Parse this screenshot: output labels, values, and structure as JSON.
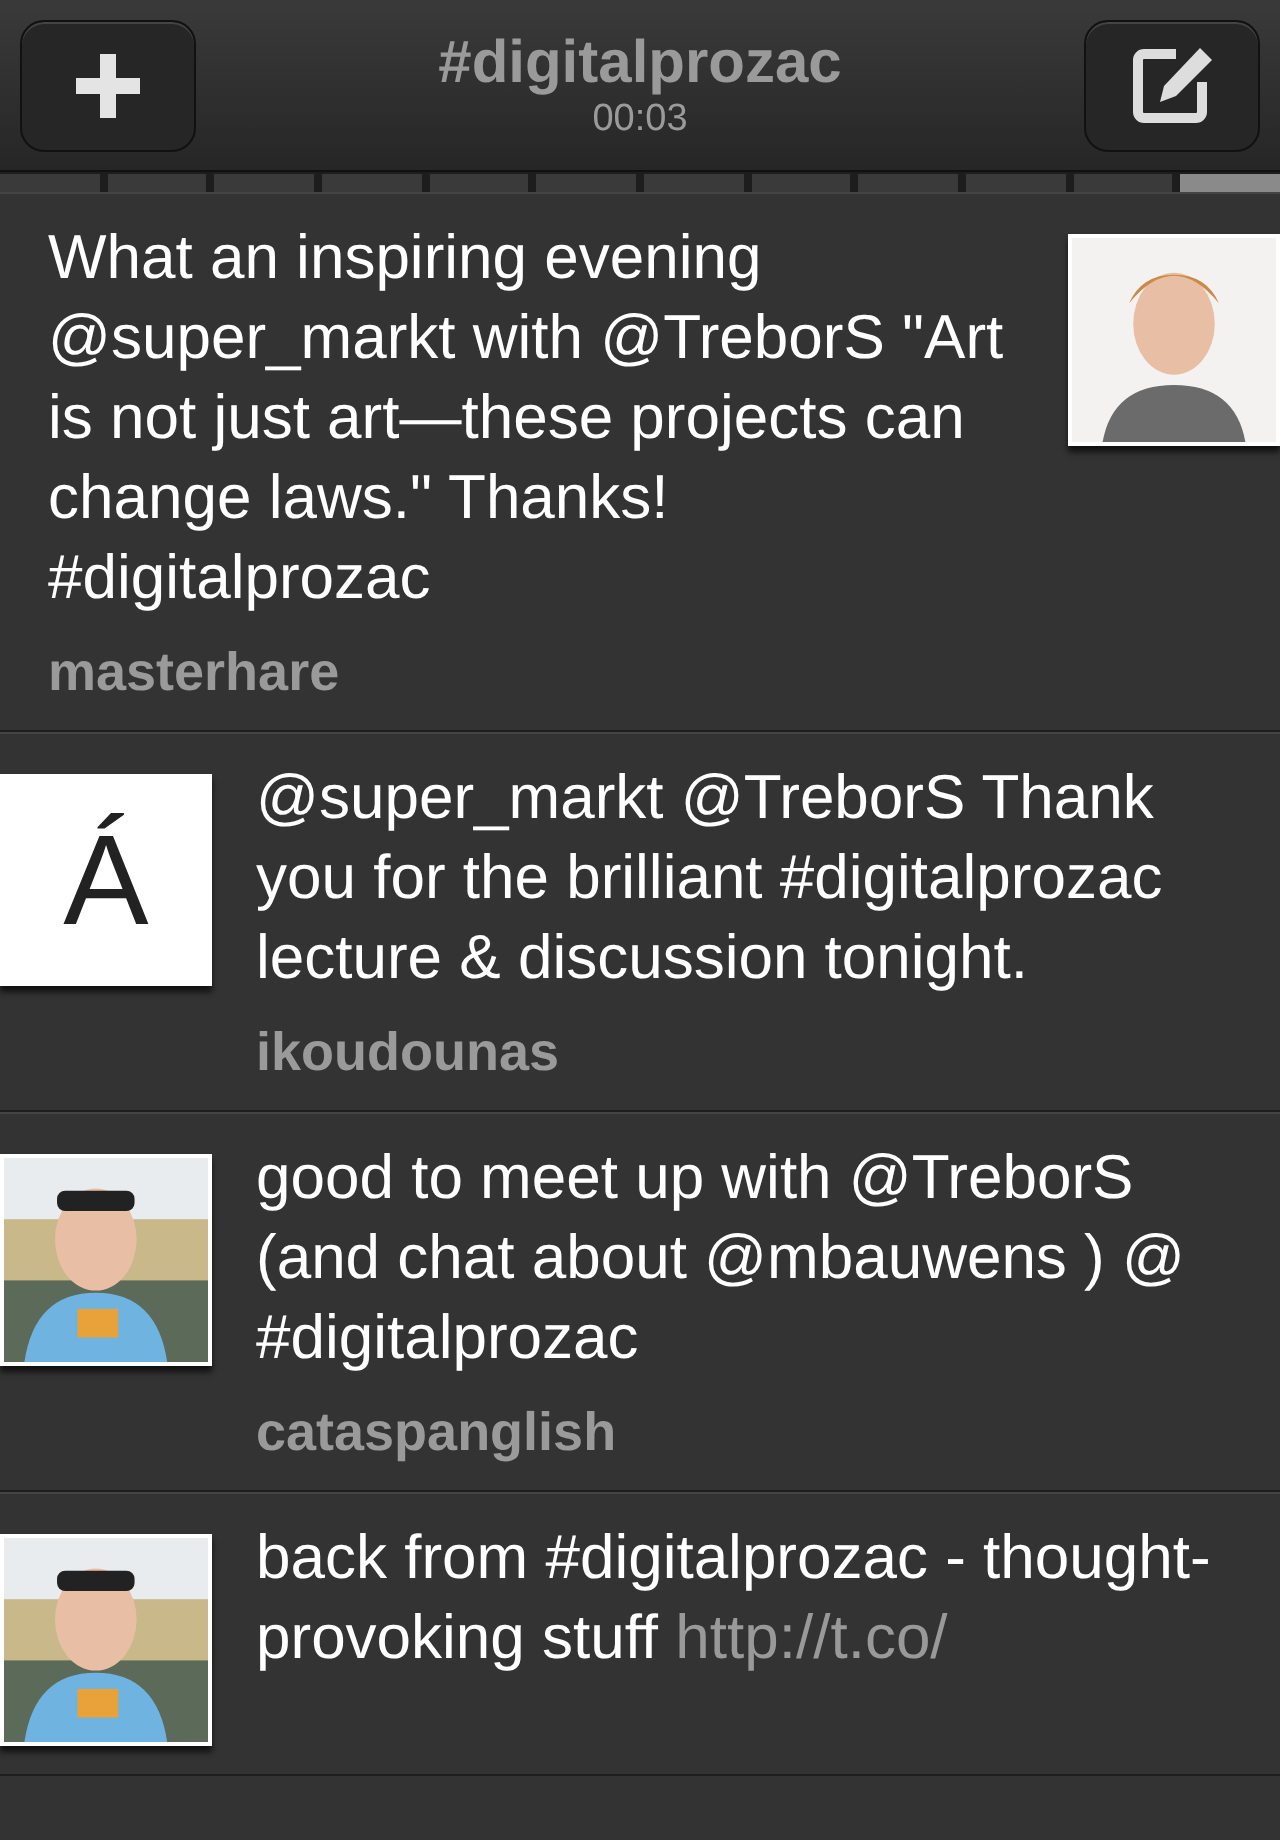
{
  "header": {
    "title": "#digitalprozac",
    "timer": "00:03"
  },
  "pages": [
    {
      "selected": false
    },
    {
      "selected": false
    },
    {
      "selected": false
    },
    {
      "selected": false
    },
    {
      "selected": false
    },
    {
      "selected": false
    },
    {
      "selected": false
    },
    {
      "selected": false
    },
    {
      "selected": false
    },
    {
      "selected": false
    },
    {
      "selected": false
    },
    {
      "selected": true
    }
  ],
  "tweets": [
    {
      "text": "What an inspiring evening @super_markt with @TreborS \"Art is not just art—these projects can change laws.\" Thanks! #digitalprozac",
      "author": "masterhare",
      "avatar": {
        "on_right": true,
        "kind": "picture"
      }
    },
    {
      "text": "@super_markt @TreborS Thank you for the brilliant #digitalprozac lecture & discussion tonight.",
      "author": "ikoudounas",
      "avatar": {
        "on_right": false,
        "kind": "letter",
        "letter": "Á"
      }
    },
    {
      "text": "good to meet up with @TreborS (and chat about @mbauwens ) @ #digitalprozac",
      "author": "cataspanglish",
      "avatar": {
        "on_right": false,
        "kind": "picture"
      }
    },
    {
      "text": "back from #digitalprozac - thought-provoking stuff",
      "link": "http://t.co/",
      "avatar": {
        "on_right": false,
        "kind": "picture"
      }
    }
  ]
}
